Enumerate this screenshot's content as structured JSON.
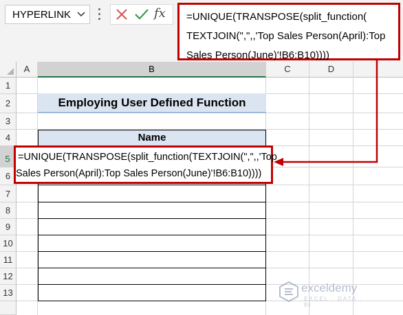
{
  "name_box": {
    "value": "HYPERLINK"
  },
  "formula_buttons": {
    "cancel": "✕",
    "enter": "✓",
    "fx": "fx"
  },
  "formula_bar": {
    "lines": [
      "=UNIQUE(TRANSPOSE(split_function(",
      "TEXTJOIN(\",\",,'Top Sales Person(April):Top",
      "Sales Person(June)'!B6:B10))))"
    ]
  },
  "columns": [
    "A",
    "B",
    "C",
    "D"
  ],
  "rows": [
    "1",
    "2",
    "3",
    "4",
    "5",
    "6",
    "7",
    "8",
    "9",
    "10",
    "11",
    "12",
    "13"
  ],
  "sheet": {
    "title": "Employing User Defined Function",
    "table_header": "Name",
    "edit_lines": [
      "=UNIQUE(TRANSPOSE(split_function(TEXTJOIN(\",\",,'Top",
      "Sales Person(April):Top Sales Person(June)'!B6:B10))))"
    ]
  },
  "watermark": {
    "name": "exceldemy",
    "tagline": "EXCEL · DATA · BI"
  },
  "colors": {
    "highlight": "#c00000",
    "header_fill": "#dbe5f1",
    "select_green": "#217346"
  }
}
